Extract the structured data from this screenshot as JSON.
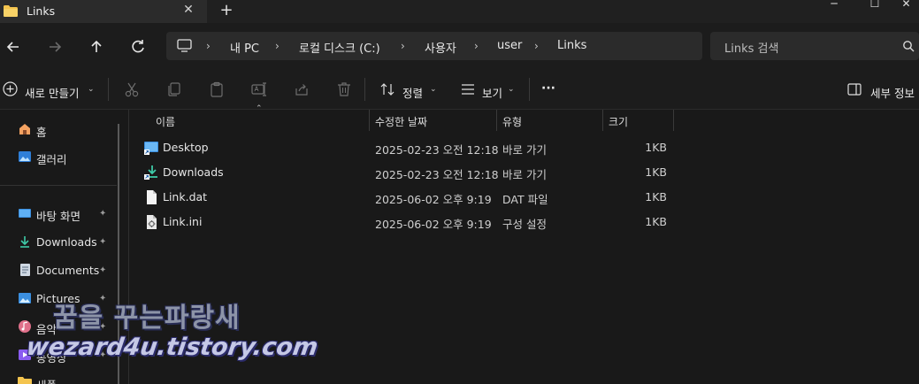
{
  "window": {
    "tab_title": "Links",
    "tab_close": "✕",
    "new_tab": "+",
    "minimize": "─",
    "maximize": "☐",
    "close": "✕"
  },
  "nav": {
    "breadcrumbs": [
      "내 PC",
      "로컬 디스크 (C:)",
      "사용자",
      "user",
      "Links"
    ],
    "search_placeholder": "Links 검색"
  },
  "commands": {
    "new_label": "새로 만들기",
    "sort_label": "정렬",
    "view_label": "보기",
    "more_label": "···",
    "details_label": "세부 정보",
    "icons": [
      "cut-icon",
      "copy-icon",
      "paste-icon",
      "rename-icon",
      "share-icon",
      "delete-icon"
    ]
  },
  "sidebar": {
    "items": [
      {
        "label": "홈",
        "icon": "home-icon",
        "pinned": false
      },
      {
        "label": "갤러리",
        "icon": "gallery-icon",
        "pinned": false
      },
      {
        "label": "바탕 화면",
        "icon": "desktop-icon",
        "pinned": true
      },
      {
        "label": "Downloads",
        "icon": "downloads-icon",
        "pinned": true
      },
      {
        "label": "Documents",
        "icon": "documents-icon",
        "pinned": true
      },
      {
        "label": "Pictures",
        "icon": "pictures-icon",
        "pinned": true
      },
      {
        "label": "음악",
        "icon": "music-icon",
        "pinned": true
      },
      {
        "label": "동영상",
        "icon": "videos-icon",
        "pinned": true
      },
      {
        "label": "새폴",
        "icon": "folder-icon",
        "pinned": false
      }
    ],
    "pin_glyph": "📌"
  },
  "table": {
    "headers": {
      "name": "이름",
      "date": "수정한 날짜",
      "type": "유형",
      "size": "크기"
    },
    "rows": [
      {
        "name": "Desktop",
        "date": "2025-02-23 오전 12:18",
        "type": "바로 가기",
        "size": "1KB",
        "icon": "desktop-shortcut-icon"
      },
      {
        "name": "Downloads",
        "date": "2025-02-23 오전 12:18",
        "type": "바로 가기",
        "size": "1KB",
        "icon": "downloads-shortcut-icon"
      },
      {
        "name": "Link.dat",
        "date": "2025-06-02 오후 9:19",
        "type": "DAT 파일",
        "size": "1KB",
        "icon": "file-icon"
      },
      {
        "name": "Link.ini",
        "date": "2025-06-02 오후 9:19",
        "type": "구성 설정",
        "size": "1KB",
        "icon": "config-file-icon"
      }
    ]
  },
  "watermark": {
    "line1": "꿈을 꾸는파랑새",
    "line2": "wezard4u.tistory.com"
  },
  "colors": {
    "background": "#191919",
    "accent_blue": "#4cc2ff",
    "folder_yellow": "#f4c44e"
  }
}
